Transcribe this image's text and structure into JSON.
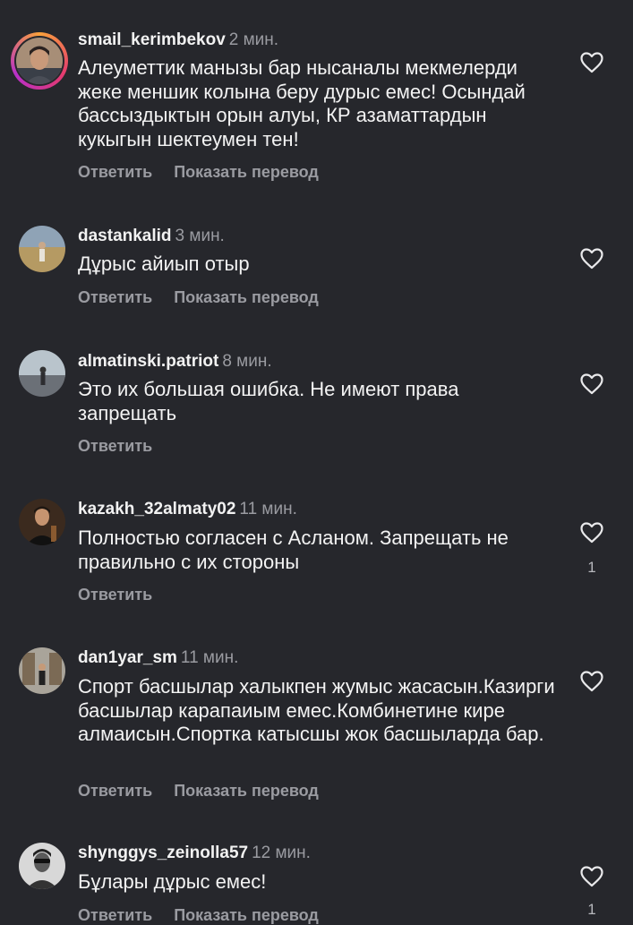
{
  "comments": [
    {
      "username": "smail_kerimbekov",
      "time": "2 мин.",
      "text": "Алеуметтик манызы бар нысаналы мекмелерди жеке меншик колына беру дурыс емес! Осындай бассыздыктын орын алуы, КР азаматтардын кукыгын шектеумен тен!",
      "reply_label": "Ответить",
      "translate_label": "Показать перевод",
      "likes": ""
    },
    {
      "username": "dastankalid",
      "time": "3 мин.",
      "text": "Дұрыс айиып отыр",
      "reply_label": "Ответить",
      "translate_label": "Показать перевод",
      "likes": ""
    },
    {
      "username": "almatinski.patriot",
      "time": "8 мин.",
      "text": "Это их большая ошибка. Не имеют права запрещать",
      "reply_label": "Ответить",
      "translate_label": "",
      "likes": ""
    },
    {
      "username": "kazakh_32almaty02",
      "time": "11 мин.",
      "text": "Полностью согласен с Асланом. Запрещать не правильно с их стороны",
      "reply_label": "Ответить",
      "translate_label": "",
      "likes": "1"
    },
    {
      "username": "dan1yar_sm",
      "time": "11 мин.",
      "text": "Спорт басшылар халыкпен жумыс жасасын.Казирги басшылар карапаиым емес.Комбинетине кире алмаисын.Спортка катысшы жок басшыларда бар.",
      "reply_label": "Ответить",
      "translate_label": "Показать перевод",
      "likes": ""
    },
    {
      "username": "shynggys_zeinolla57",
      "time": "12 мин.",
      "text": "Бұлары дұрыс емес!",
      "reply_label": "Ответить",
      "translate_label": "Показать перевод",
      "likes": "1"
    }
  ],
  "colors": {
    "background": "#26272c",
    "text": "#f3f3f3",
    "secondary": "#9a9ba1",
    "story_ring": "#e43a6f"
  },
  "icons": {
    "like": "heart-outline-icon",
    "avatar": "profile-photo"
  }
}
